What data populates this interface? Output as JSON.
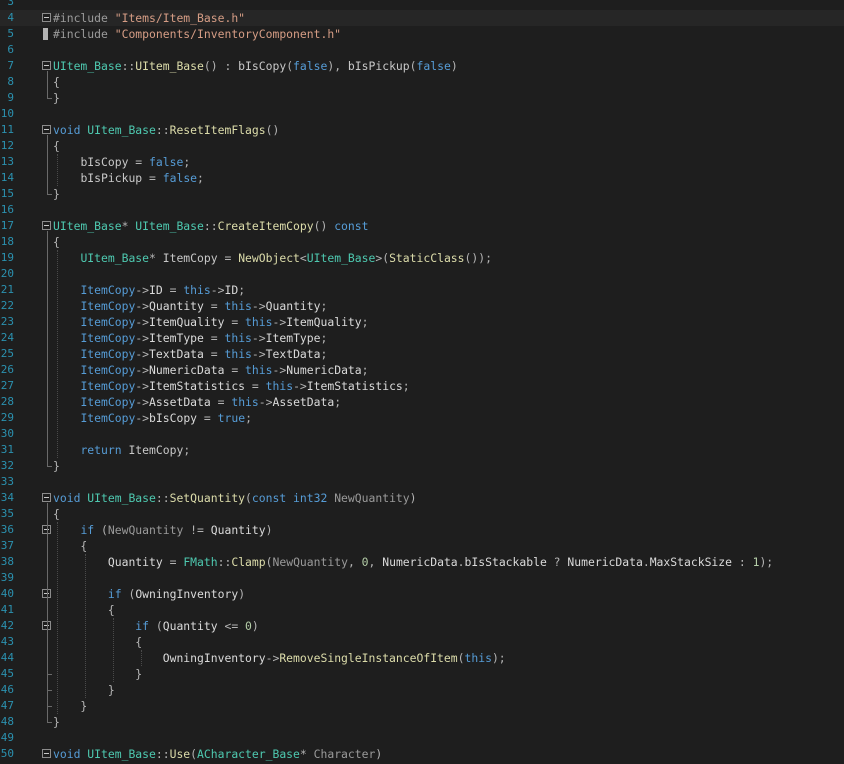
{
  "editor": {
    "lines": [
      {
        "n": "3",
        "tokens": []
      },
      {
        "n": "4",
        "fold": true,
        "tokens": [
          [
            "pp",
            "#include "
          ],
          [
            "str",
            "\"Items/Item_Base.h\""
          ]
        ]
      },
      {
        "n": "5",
        "marker": true,
        "tokens": [
          [
            "pp",
            "#include "
          ],
          [
            "str",
            "\"Components/InventoryComponent.h\""
          ]
        ]
      },
      {
        "n": "6",
        "tokens": []
      },
      {
        "n": "7",
        "fold": true,
        "tokens": [
          [
            "ty",
            "UItem_Base"
          ],
          [
            "op",
            "::"
          ],
          [
            "fn",
            "UItem_Base"
          ],
          [
            "op",
            "() : "
          ],
          [
            "id",
            "bIsCopy"
          ],
          [
            "op",
            "("
          ],
          [
            "kw",
            "false"
          ],
          [
            "op",
            "), "
          ],
          [
            "id",
            "bIsPickup"
          ],
          [
            "op",
            "("
          ],
          [
            "kw",
            "false"
          ],
          [
            "op",
            ")"
          ]
        ]
      },
      {
        "n": "8",
        "tokens": [
          [
            "op",
            "{"
          ]
        ]
      },
      {
        "n": "9",
        "tokens": [
          [
            "op",
            "}"
          ]
        ]
      },
      {
        "n": "10",
        "tokens": []
      },
      {
        "n": "11",
        "fold": true,
        "tokens": [
          [
            "kw",
            "void "
          ],
          [
            "ty",
            "UItem_Base"
          ],
          [
            "op",
            "::"
          ],
          [
            "fn",
            "ResetItemFlags"
          ],
          [
            "op",
            "()"
          ]
        ]
      },
      {
        "n": "12",
        "tokens": [
          [
            "op",
            "{"
          ]
        ]
      },
      {
        "n": "13",
        "tokens": [
          [
            "op",
            "    "
          ],
          [
            "id",
            "bIsCopy"
          ],
          [
            "op",
            " = "
          ],
          [
            "kw",
            "false"
          ],
          [
            "op",
            ";"
          ]
        ]
      },
      {
        "n": "14",
        "tokens": [
          [
            "op",
            "    "
          ],
          [
            "id",
            "bIsPickup"
          ],
          [
            "op",
            " = "
          ],
          [
            "kw",
            "false"
          ],
          [
            "op",
            ";"
          ]
        ]
      },
      {
        "n": "15",
        "tokens": [
          [
            "op",
            "}"
          ]
        ]
      },
      {
        "n": "16",
        "tokens": []
      },
      {
        "n": "17",
        "fold": true,
        "tokens": [
          [
            "ty",
            "UItem_Base"
          ],
          [
            "op",
            "* "
          ],
          [
            "ty",
            "UItem_Base"
          ],
          [
            "op",
            "::"
          ],
          [
            "fn",
            "CreateItemCopy"
          ],
          [
            "op",
            "() "
          ],
          [
            "kw",
            "const"
          ]
        ]
      },
      {
        "n": "18",
        "tokens": [
          [
            "op",
            "{"
          ]
        ]
      },
      {
        "n": "19",
        "tokens": [
          [
            "op",
            "    "
          ],
          [
            "ty",
            "UItem_Base"
          ],
          [
            "op",
            "* "
          ],
          [
            "id",
            "ItemCopy"
          ],
          [
            "op",
            " = "
          ],
          [
            "fn",
            "NewObject"
          ],
          [
            "op",
            "<"
          ],
          [
            "ty",
            "UItem_Base"
          ],
          [
            "op",
            ">("
          ],
          [
            "fn",
            "StaticClass"
          ],
          [
            "op",
            "());"
          ]
        ]
      },
      {
        "n": "20",
        "tokens": []
      },
      {
        "n": "21",
        "tokens": [
          [
            "op",
            "    "
          ],
          [
            "cur",
            "ItemCopy"
          ],
          [
            "op",
            "->"
          ],
          [
            "mem",
            "ID"
          ],
          [
            "op",
            " = "
          ],
          [
            "kw",
            "this"
          ],
          [
            "op",
            "->"
          ],
          [
            "mem",
            "ID"
          ],
          [
            "op",
            ";"
          ]
        ]
      },
      {
        "n": "22",
        "tokens": [
          [
            "op",
            "    "
          ],
          [
            "cur",
            "ItemCopy"
          ],
          [
            "op",
            "->"
          ],
          [
            "mem",
            "Quantity"
          ],
          [
            "op",
            " = "
          ],
          [
            "kw",
            "this"
          ],
          [
            "op",
            "->"
          ],
          [
            "mem",
            "Quantity"
          ],
          [
            "op",
            ";"
          ]
        ]
      },
      {
        "n": "23",
        "tokens": [
          [
            "op",
            "    "
          ],
          [
            "cur",
            "ItemCopy"
          ],
          [
            "op",
            "->"
          ],
          [
            "mem",
            "ItemQuality"
          ],
          [
            "op",
            " = "
          ],
          [
            "kw",
            "this"
          ],
          [
            "op",
            "->"
          ],
          [
            "mem",
            "ItemQuality"
          ],
          [
            "op",
            ";"
          ]
        ]
      },
      {
        "n": "24",
        "tokens": [
          [
            "op",
            "    "
          ],
          [
            "cur",
            "ItemCopy"
          ],
          [
            "op",
            "->"
          ],
          [
            "mem",
            "ItemType"
          ],
          [
            "op",
            " = "
          ],
          [
            "kw",
            "this"
          ],
          [
            "op",
            "->"
          ],
          [
            "mem",
            "ItemType"
          ],
          [
            "op",
            ";"
          ]
        ]
      },
      {
        "n": "25",
        "tokens": [
          [
            "op",
            "    "
          ],
          [
            "cur",
            "ItemCopy"
          ],
          [
            "op",
            "->"
          ],
          [
            "mem",
            "TextData"
          ],
          [
            "op",
            " = "
          ],
          [
            "kw",
            "this"
          ],
          [
            "op",
            "->"
          ],
          [
            "mem",
            "TextData"
          ],
          [
            "op",
            ";"
          ]
        ]
      },
      {
        "n": "26",
        "tokens": [
          [
            "op",
            "    "
          ],
          [
            "cur",
            "ItemCopy"
          ],
          [
            "op",
            "->"
          ],
          [
            "mem",
            "NumericData"
          ],
          [
            "op",
            " = "
          ],
          [
            "kw",
            "this"
          ],
          [
            "op",
            "->"
          ],
          [
            "mem",
            "NumericData"
          ],
          [
            "op",
            ";"
          ]
        ]
      },
      {
        "n": "27",
        "tokens": [
          [
            "op",
            "    "
          ],
          [
            "cur",
            "ItemCopy"
          ],
          [
            "op",
            "->"
          ],
          [
            "mem",
            "ItemStatistics"
          ],
          [
            "op",
            " = "
          ],
          [
            "kw",
            "this"
          ],
          [
            "op",
            "->"
          ],
          [
            "mem",
            "ItemStatistics"
          ],
          [
            "op",
            ";"
          ]
        ]
      },
      {
        "n": "28",
        "tokens": [
          [
            "op",
            "    "
          ],
          [
            "cur",
            "ItemCopy"
          ],
          [
            "op",
            "->"
          ],
          [
            "mem",
            "AssetData"
          ],
          [
            "op",
            " = "
          ],
          [
            "kw",
            "this"
          ],
          [
            "op",
            "->"
          ],
          [
            "mem",
            "AssetData"
          ],
          [
            "op",
            ";"
          ]
        ]
      },
      {
        "n": "29",
        "tokens": [
          [
            "op",
            "    "
          ],
          [
            "cur",
            "ItemCopy"
          ],
          [
            "op",
            "->"
          ],
          [
            "mem",
            "bIsCopy"
          ],
          [
            "op",
            " = "
          ],
          [
            "kw",
            "true"
          ],
          [
            "op",
            ";"
          ]
        ]
      },
      {
        "n": "30",
        "tokens": []
      },
      {
        "n": "31",
        "tokens": [
          [
            "op",
            "    "
          ],
          [
            "kw",
            "return "
          ],
          [
            "id",
            "ItemCopy"
          ],
          [
            "op",
            ";"
          ]
        ]
      },
      {
        "n": "32",
        "tokens": [
          [
            "op",
            "}"
          ]
        ]
      },
      {
        "n": "33",
        "tokens": []
      },
      {
        "n": "34",
        "fold": true,
        "tokens": [
          [
            "kw",
            "void "
          ],
          [
            "ty",
            "UItem_Base"
          ],
          [
            "op",
            "::"
          ],
          [
            "fn",
            "SetQuantity"
          ],
          [
            "op",
            "("
          ],
          [
            "kw",
            "const "
          ],
          [
            "kw",
            "int32 "
          ],
          [
            "param",
            "NewQuantity"
          ],
          [
            "op",
            ")"
          ]
        ]
      },
      {
        "n": "35",
        "tokens": [
          [
            "op",
            "{"
          ]
        ]
      },
      {
        "n": "36",
        "fold": true,
        "tokens": [
          [
            "op",
            "    "
          ],
          [
            "kw",
            "if "
          ],
          [
            "op",
            "("
          ],
          [
            "param",
            "NewQuantity"
          ],
          [
            "op",
            " != "
          ],
          [
            "mem",
            "Quantity"
          ],
          [
            "op",
            ")"
          ]
        ]
      },
      {
        "n": "37",
        "tokens": [
          [
            "op",
            "    {"
          ]
        ]
      },
      {
        "n": "38",
        "tokens": [
          [
            "op",
            "        "
          ],
          [
            "mem",
            "Quantity"
          ],
          [
            "op",
            " = "
          ],
          [
            "ty",
            "FMath"
          ],
          [
            "op",
            "::"
          ],
          [
            "fn",
            "Clamp"
          ],
          [
            "op",
            "("
          ],
          [
            "param",
            "NewQuantity"
          ],
          [
            "op",
            ", "
          ],
          [
            "num",
            "0"
          ],
          [
            "op",
            ", "
          ],
          [
            "mem",
            "NumericData"
          ],
          [
            "op",
            "."
          ],
          [
            "mem",
            "bIsStackable"
          ],
          [
            "op",
            " ? "
          ],
          [
            "mem",
            "NumericData"
          ],
          [
            "op",
            "."
          ],
          [
            "mem",
            "MaxStackSize"
          ],
          [
            "op",
            " : "
          ],
          [
            "num",
            "1"
          ],
          [
            "op",
            ");"
          ]
        ]
      },
      {
        "n": "39",
        "tokens": []
      },
      {
        "n": "40",
        "fold": true,
        "tokens": [
          [
            "op",
            "        "
          ],
          [
            "kw",
            "if "
          ],
          [
            "op",
            "("
          ],
          [
            "mem",
            "OwningInventory"
          ],
          [
            "op",
            ")"
          ]
        ]
      },
      {
        "n": "41",
        "tokens": [
          [
            "op",
            "        {"
          ]
        ]
      },
      {
        "n": "42",
        "fold": true,
        "tokens": [
          [
            "op",
            "            "
          ],
          [
            "kw",
            "if "
          ],
          [
            "op",
            "("
          ],
          [
            "mem",
            "Quantity"
          ],
          [
            "op",
            " <= "
          ],
          [
            "num",
            "0"
          ],
          [
            "op",
            ")"
          ]
        ]
      },
      {
        "n": "43",
        "tokens": [
          [
            "op",
            "            {"
          ]
        ]
      },
      {
        "n": "44",
        "tokens": [
          [
            "op",
            "                "
          ],
          [
            "mem",
            "OwningInventory"
          ],
          [
            "op",
            "->"
          ],
          [
            "fn",
            "RemoveSingleInstanceOfItem"
          ],
          [
            "op",
            "("
          ],
          [
            "kw",
            "this"
          ],
          [
            "op",
            ");"
          ]
        ]
      },
      {
        "n": "45",
        "tokens": [
          [
            "op",
            "            }"
          ]
        ]
      },
      {
        "n": "46",
        "tokens": [
          [
            "op",
            "        }"
          ]
        ]
      },
      {
        "n": "47",
        "tokens": [
          [
            "op",
            "    }"
          ]
        ]
      },
      {
        "n": "48",
        "tokens": [
          [
            "op",
            "}"
          ]
        ]
      },
      {
        "n": "49",
        "tokens": []
      },
      {
        "n": "50",
        "fold": true,
        "tokens": [
          [
            "kw",
            "void "
          ],
          [
            "ty",
            "UItem_Base"
          ],
          [
            "op",
            "::"
          ],
          [
            "fn",
            "Use"
          ],
          [
            "op",
            "("
          ],
          [
            "ty",
            "ACharacter_Base"
          ],
          [
            "op",
            "* "
          ],
          [
            "param",
            "Character"
          ],
          [
            "op",
            ")"
          ]
        ]
      }
    ],
    "current_line": "4"
  }
}
